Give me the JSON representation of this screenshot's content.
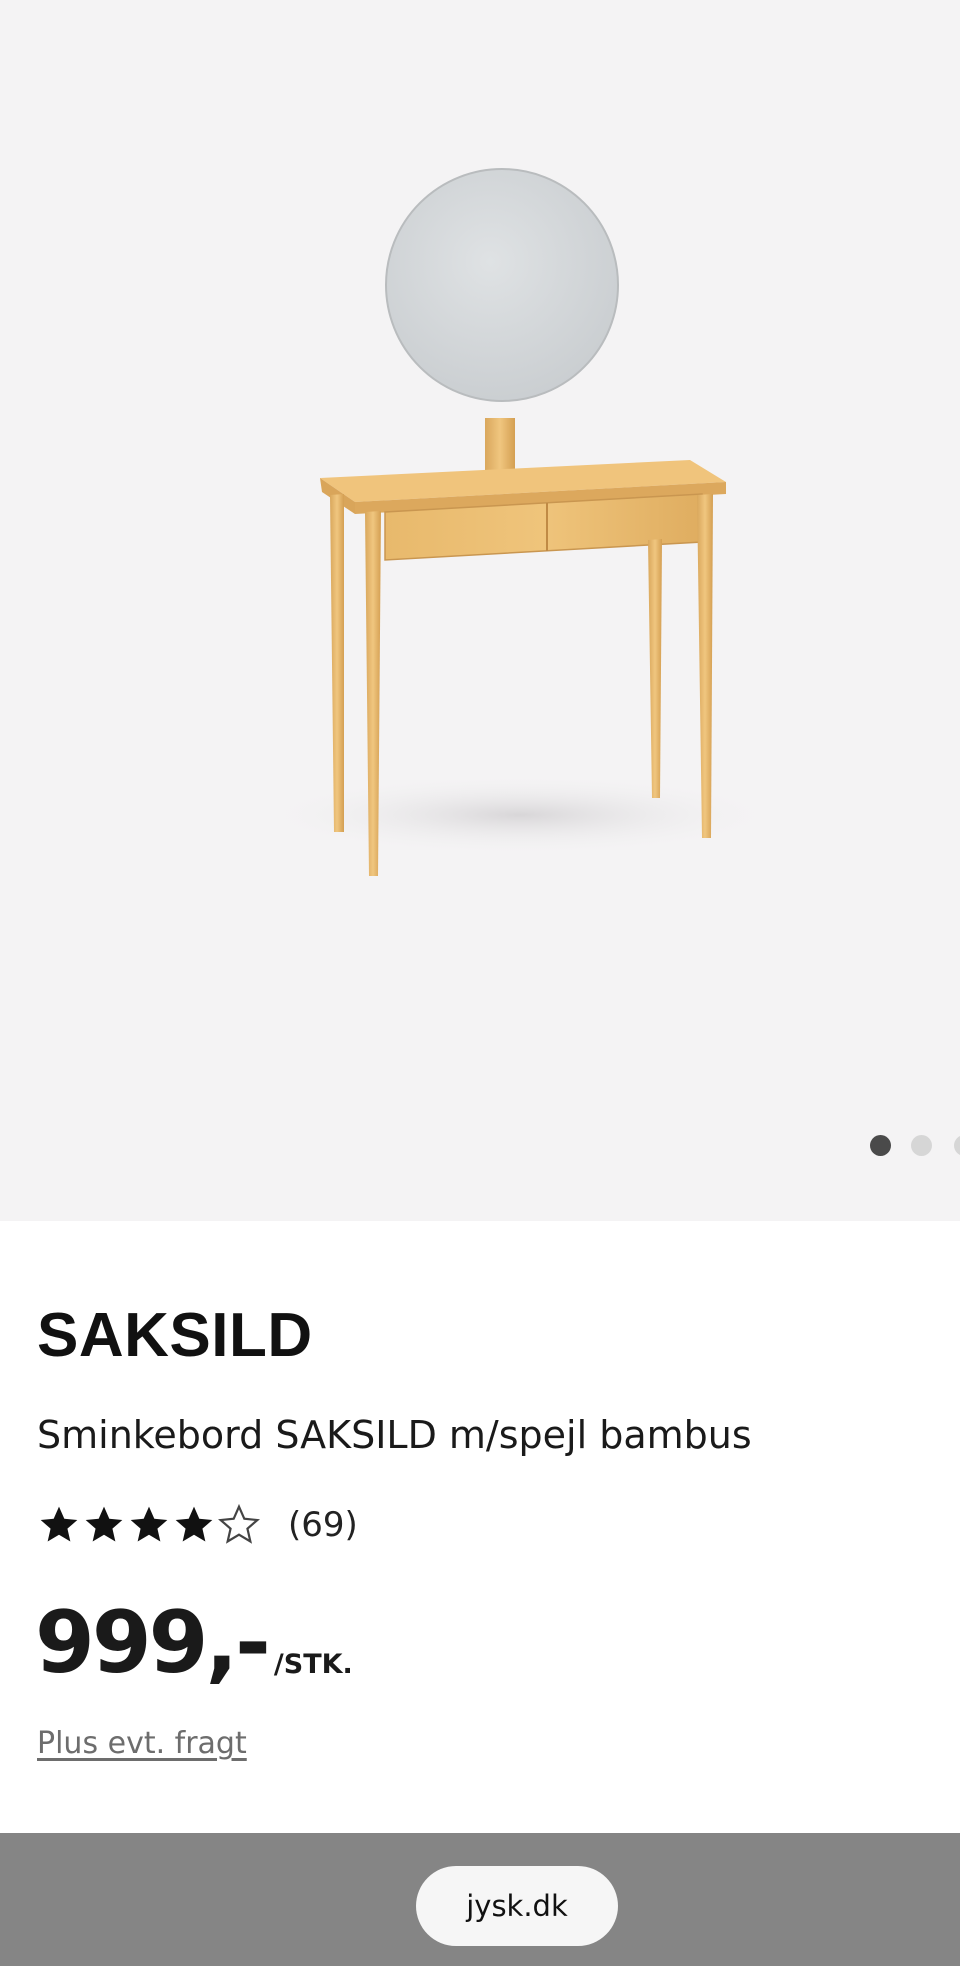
{
  "product": {
    "brand_title": "SAKSILD",
    "description": "Sminkebord SAKSILD m/spejl bambus",
    "rating": 4,
    "rating_max": 5,
    "review_count": "(69)",
    "price": "999,-",
    "price_unit": "/STK.",
    "shipping_note": "Plus evt. fragt"
  },
  "gallery": {
    "image_subject": "dressing table with round mirror, bamboo",
    "current_slide": 1,
    "visible_dots": 3
  },
  "browser": {
    "url": "jysk.dk"
  },
  "colors": {
    "gallery_bg": "#f4f3f4",
    "bamboo": "#e3b36a",
    "text": "#111111",
    "link": "#6d6d6d",
    "browser_bar": "#858585"
  }
}
